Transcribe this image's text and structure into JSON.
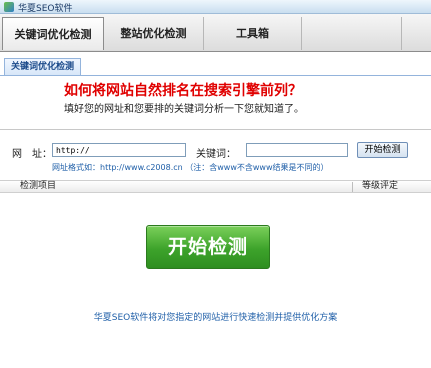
{
  "window": {
    "title": "华夏SEO软件"
  },
  "nav": {
    "tabs": [
      {
        "label": "关键词优化检测",
        "active": true
      },
      {
        "label": "整站优化检测",
        "active": false
      },
      {
        "label": "工具箱",
        "active": false
      }
    ]
  },
  "subtab": {
    "label": "关键词优化检测"
  },
  "intro": {
    "headline": "如何将网站自然排名在搜索引擎前列？",
    "description": "填好您的网址和您要排的关键词分析一下您就知道了。"
  },
  "form": {
    "url_label": "网　址：",
    "url_value": "http://",
    "keyword_label": "关键词：",
    "keyword_value": "",
    "start_button": "开始检测",
    "hint": "网址格式如：http://www.c2008.cn （注：含www不含www结果是不同的）"
  },
  "table": {
    "col_item": "检测项目",
    "col_rating": "等级评定"
  },
  "main_button": "开始检测",
  "footer": "华夏SEO软件将对您指定的网站进行快速检测并提供优化方案",
  "colors": {
    "headline": "#e00000",
    "accent_link": "#1f5fa8",
    "button_green": "#3da32b"
  }
}
